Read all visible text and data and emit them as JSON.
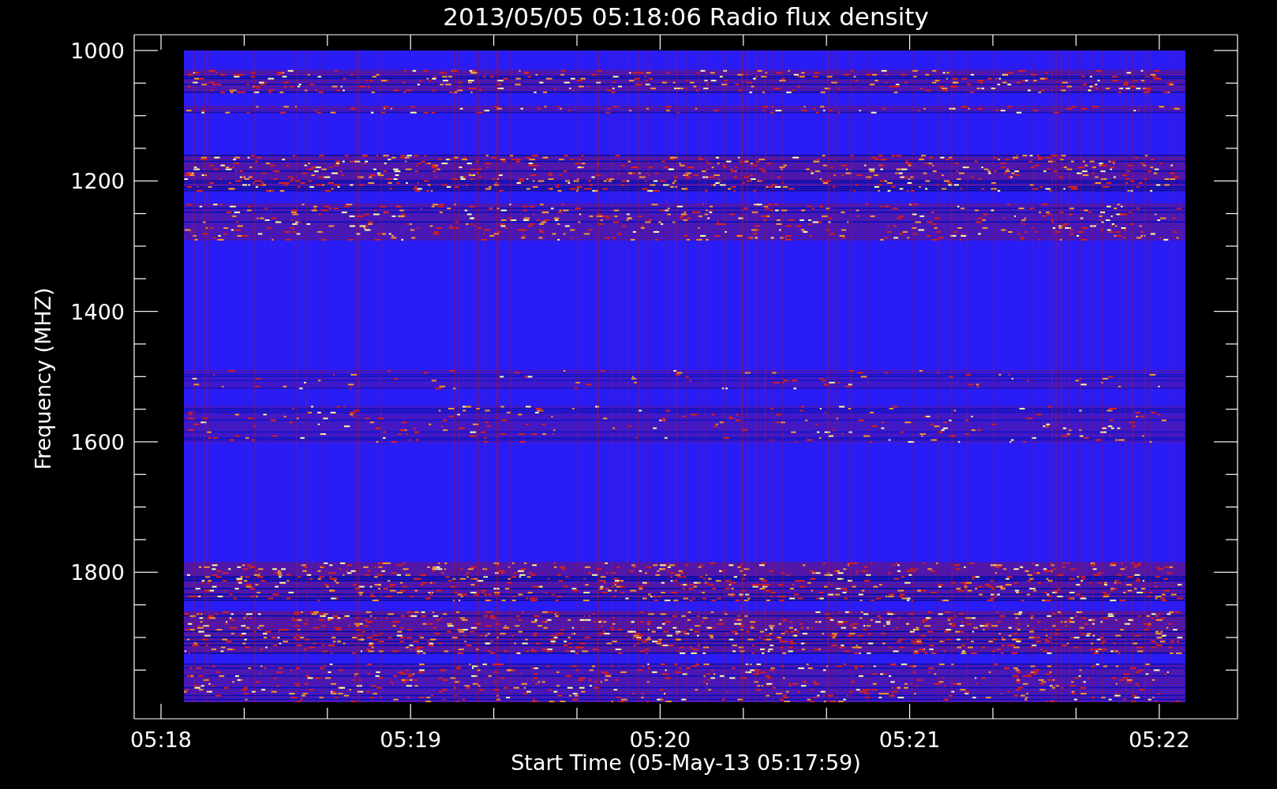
{
  "title": "2013/05/05 05:18:06 Radio flux density",
  "y_axis": {
    "label": "Frequency (MHZ)",
    "ticks": [
      "1000",
      "1200",
      "1400",
      "1600",
      "1800"
    ]
  },
  "x_axis": {
    "label": "Start Time (05-May-13 05:17:59)",
    "ticks": [
      "05:18",
      "05:19",
      "05:20",
      "05:21",
      "05:22"
    ]
  }
}
